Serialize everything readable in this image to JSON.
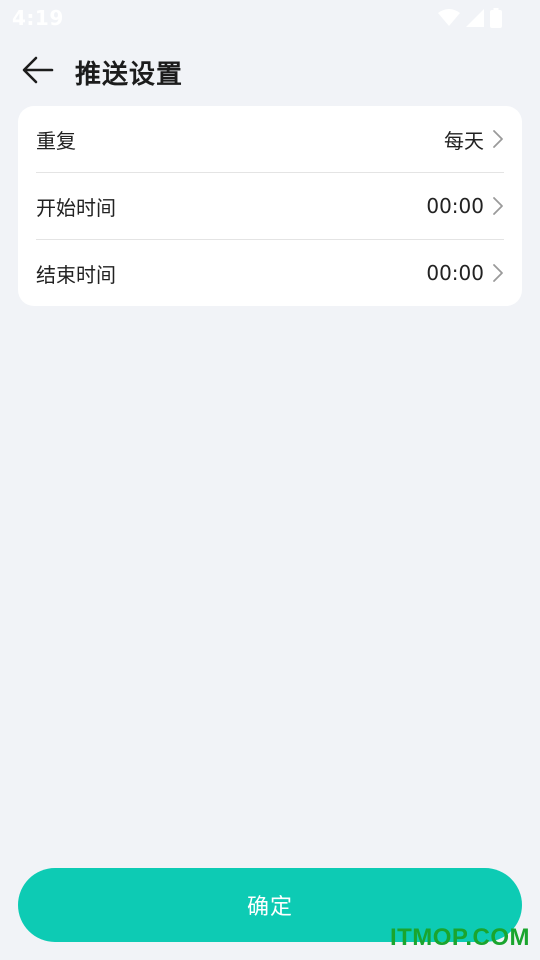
{
  "status_bar": {
    "time": "4:19"
  },
  "header": {
    "title": "推送设置"
  },
  "settings": {
    "rows": [
      {
        "label": "重复",
        "value": "每天"
      },
      {
        "label": "开始时间",
        "value": "00:00"
      },
      {
        "label": "结束时间",
        "value": "00:00"
      }
    ]
  },
  "footer": {
    "confirm_label": "确定"
  },
  "watermark": "ITMOP.COM",
  "colors": {
    "background": "#f1f3f7",
    "card": "#ffffff",
    "accent": "#0dcbb4",
    "watermark": "#1aa52e"
  }
}
